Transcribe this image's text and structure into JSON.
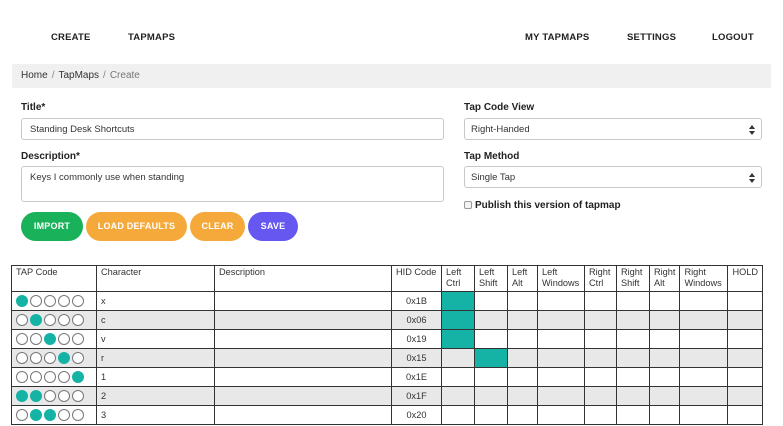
{
  "nav": {
    "create": "CREATE",
    "tapmaps": "TAPMAPS",
    "my_tapmaps": "MY TAPMAPS",
    "settings": "SETTINGS",
    "logout": "LOGOUT"
  },
  "breadcrumb": {
    "home": "Home",
    "separator": "/",
    "tapmaps": "TapMaps",
    "current": "Create"
  },
  "form": {
    "title_label": "Title*",
    "title_value": "Standing Desk Shortcuts",
    "description_label": "Description*",
    "description_value": "Keys I commonly use when standing",
    "tap_code_view_label": "Tap Code View",
    "tap_code_view_value": "Right-Handed",
    "tap_method_label": "Tap Method",
    "tap_method_value": "Single Tap",
    "publish_label": "Publish this version of tapmap",
    "publish_checked": false
  },
  "buttons": {
    "import": "IMPORT",
    "load_defaults": "LOAD DEFAULTS",
    "clear": "CLEAR",
    "save": "SAVE"
  },
  "colors": {
    "accent_teal": "#14b3a5",
    "import_green": "#19b15a",
    "orange": "#f5a93a",
    "save_purple": "#6657f0"
  },
  "table": {
    "headers": [
      "TAP Code",
      "Character",
      "Description",
      "HID Code",
      "Left Ctrl",
      "Left Shift",
      "Left Alt",
      "Left Windows",
      "Right Ctrl",
      "Right Shift",
      "Right Alt",
      "Right Windows",
      "HOLD"
    ],
    "rows": [
      {
        "tap": [
          1,
          0,
          0,
          0,
          0
        ],
        "character": "x",
        "description": "",
        "hid": "0x1B",
        "mods": [
          1,
          0,
          0,
          0,
          0,
          0,
          0,
          0,
          0
        ]
      },
      {
        "tap": [
          0,
          1,
          0,
          0,
          0
        ],
        "character": "c",
        "description": "",
        "hid": "0x06",
        "mods": [
          1,
          0,
          0,
          0,
          0,
          0,
          0,
          0,
          0
        ]
      },
      {
        "tap": [
          0,
          0,
          1,
          0,
          0
        ],
        "character": "v",
        "description": "",
        "hid": "0x19",
        "mods": [
          1,
          0,
          0,
          0,
          0,
          0,
          0,
          0,
          0
        ]
      },
      {
        "tap": [
          0,
          0,
          0,
          1,
          0
        ],
        "character": "r",
        "description": "",
        "hid": "0x15",
        "mods": [
          0,
          1,
          0,
          0,
          0,
          0,
          0,
          0,
          0
        ]
      },
      {
        "tap": [
          0,
          0,
          0,
          0,
          1
        ],
        "character": "1",
        "description": "",
        "hid": "0x1E",
        "mods": [
          0,
          0,
          0,
          0,
          0,
          0,
          0,
          0,
          0
        ]
      },
      {
        "tap": [
          1,
          1,
          0,
          0,
          0
        ],
        "character": "2",
        "description": "",
        "hid": "0x1F",
        "mods": [
          0,
          0,
          0,
          0,
          0,
          0,
          0,
          0,
          0
        ]
      },
      {
        "tap": [
          0,
          1,
          1,
          0,
          0
        ],
        "character": "3",
        "description": "",
        "hid": "0x20",
        "mods": [
          0,
          0,
          0,
          0,
          0,
          0,
          0,
          0,
          0
        ]
      }
    ]
  }
}
